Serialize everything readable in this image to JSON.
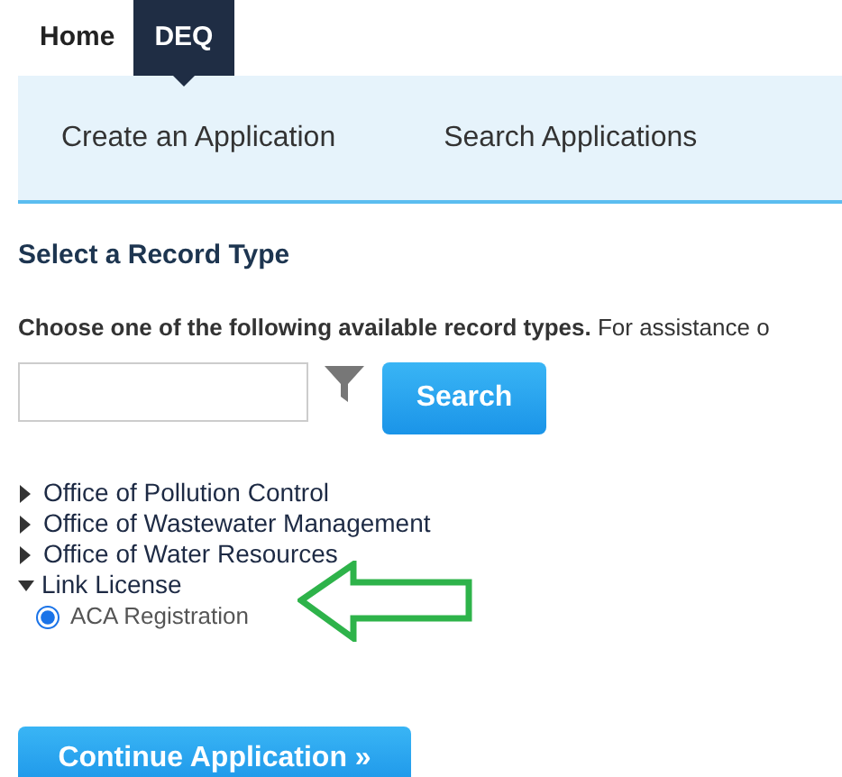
{
  "top_tabs": [
    {
      "label": "Home",
      "selected": false
    },
    {
      "label": "DEQ",
      "selected": true
    }
  ],
  "sub_menu": [
    "Create an Application",
    "Search Applications"
  ],
  "section_title": "Select a Record Type",
  "instructions": "**Choose one of the following available record types.** For assistance o",
  "search_button": "Search",
  "record_types": [
    {
      "label": "Office of Pollution Control",
      "expanded": false
    },
    {
      "label": "Office of Wastewater Management",
      "expanded": false
    },
    {
      "label": "Office of Water Resources",
      "expanded": false
    },
    {
      "label": "Link License",
      "expanded": true,
      "children": [
        {
          "label": "ACA Registration",
          "selected": true
        }
      ]
    }
  ],
  "continue_button": "Continue Application »"
}
